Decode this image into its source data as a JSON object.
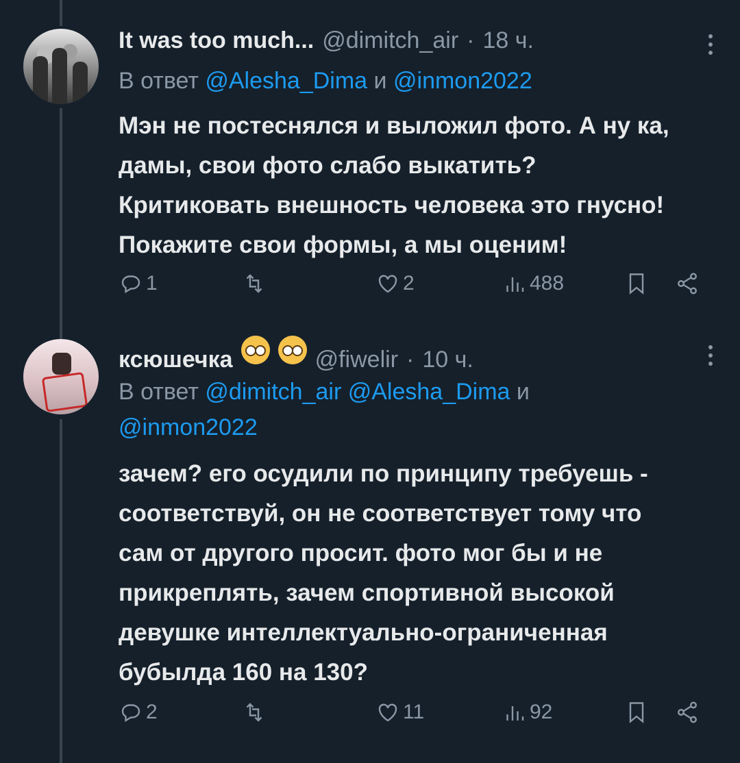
{
  "tweets": [
    {
      "name": "It was too much...",
      "handle": "@dimitch_air",
      "time": "18 ч.",
      "reply_prefix": "В ответ",
      "reply_mentions": [
        "@Alesha_Dima",
        "@inmon2022"
      ],
      "reply_and": "и",
      "text_lines": [
        "Мэн не постеснялся и выложил фото. А ну ка,",
        "дамы, свои фото слабо выкатить?",
        "Критиковать внешность человека это гнусно!",
        "Покажите свои формы, а мы оценим!"
      ],
      "actions": {
        "replies": "1",
        "likes": "2",
        "views": "488"
      }
    },
    {
      "name": "ксюшечка",
      "handle": "@fiwelir",
      "time": "10 ч.",
      "emoji_icons": [
        "pleading-face-icon",
        "flushed-face-icon"
      ],
      "reply_prefix": "В ответ",
      "reply_mentions": [
        "@dimitch_air",
        "@Alesha_Dima",
        "@inmon2022"
      ],
      "reply_and": "и",
      "text_lines": [
        "зачем? его осудили по принципу требуешь -",
        "соответствуй, он не соответствует тому что",
        "сам от другого просит. фото мог бы и не",
        "прикреплять, зачем спортивной высокой",
        "девушке интеллектуально-ограниченная",
        "бубылда 160 на 130?"
      ],
      "actions": {
        "replies": "2",
        "likes": "11",
        "views": "92"
      }
    }
  ],
  "colors": {
    "background": "#15202b",
    "link": "#1d9bf0",
    "muted": "#8b98a5",
    "text": "#e7e9ea"
  }
}
